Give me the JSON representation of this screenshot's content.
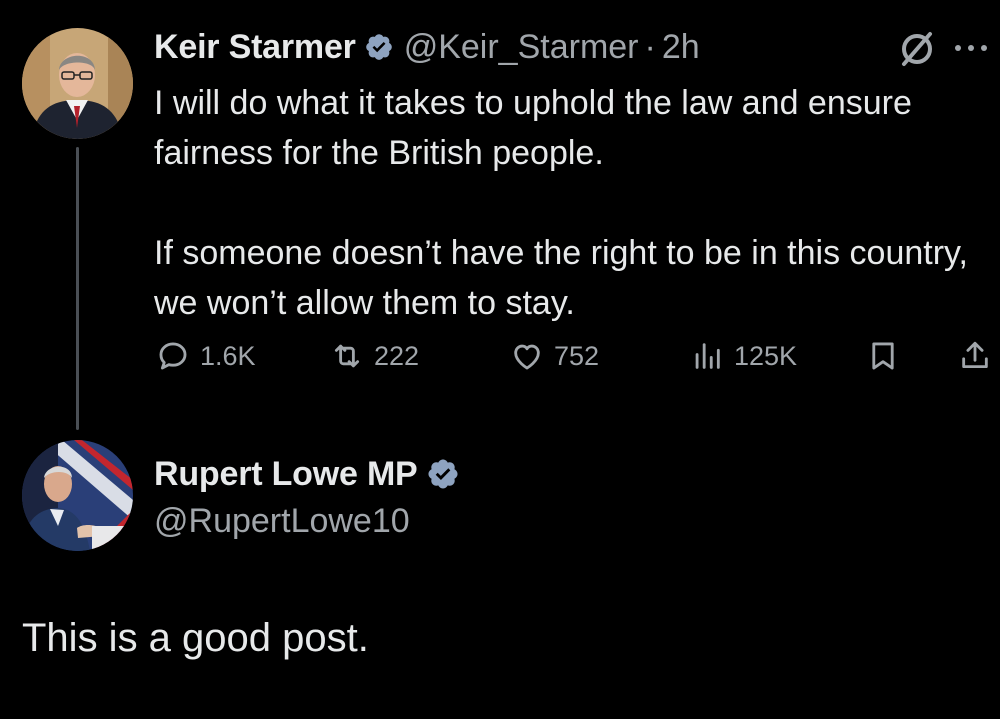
{
  "tweet": {
    "author": {
      "display_name": "Keir Starmer",
      "handle": "@Keir_Starmer",
      "separator": "·",
      "time": "2h",
      "verified": true
    },
    "text": [
      "I will do what it takes to uphold the law and ensure fairness for the British people.",
      "If someone doesn’t have the right to be in this country, we won’t allow them to stay."
    ],
    "stats": {
      "replies": "1.6K",
      "reposts": "222",
      "likes": "752",
      "views": "125K"
    },
    "icons": {
      "grok": "grok-icon",
      "more": "more-icon",
      "reply": "reply-icon",
      "repost": "repost-icon",
      "like": "heart-icon",
      "views": "views-icon",
      "bookmark": "bookmark-icon",
      "share": "share-icon"
    }
  },
  "profile": {
    "display_name": "Rupert Lowe MP",
    "handle": "@RupertLowe10",
    "verified": true
  },
  "post": {
    "text": "This is a good post."
  },
  "colors": {
    "background": "#000000",
    "primary_text": "#e7e9ea",
    "secondary_text": "#a1a6ab",
    "verified_badge": "#8ea3c0",
    "thread_line": "#4a4f55"
  }
}
